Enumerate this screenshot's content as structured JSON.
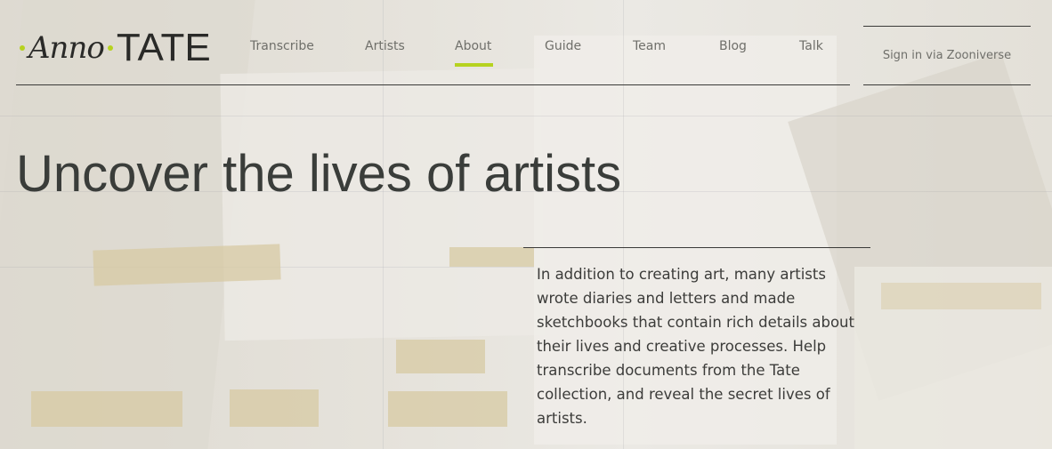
{
  "brand": {
    "script_part": "Anno",
    "caps_part": "TATE",
    "accent_color": "#b6d21f"
  },
  "nav": {
    "items": [
      {
        "label": "Transcribe"
      },
      {
        "label": "Artists"
      },
      {
        "label": "About",
        "active": true
      },
      {
        "label": "Guide"
      },
      {
        "label": "Team"
      },
      {
        "label": "Blog"
      },
      {
        "label": "Talk"
      }
    ],
    "signin_label": "Sign in via Zooniverse"
  },
  "hero": {
    "headline": "Uncover the lives of artists",
    "intro": "In addition to creating art, many artists wrote diaries and letters and made sketchbooks that contain rich details about their lives and creative processes. Help transcribe documents from the Tate collection, and reveal the secret lives of artists."
  }
}
